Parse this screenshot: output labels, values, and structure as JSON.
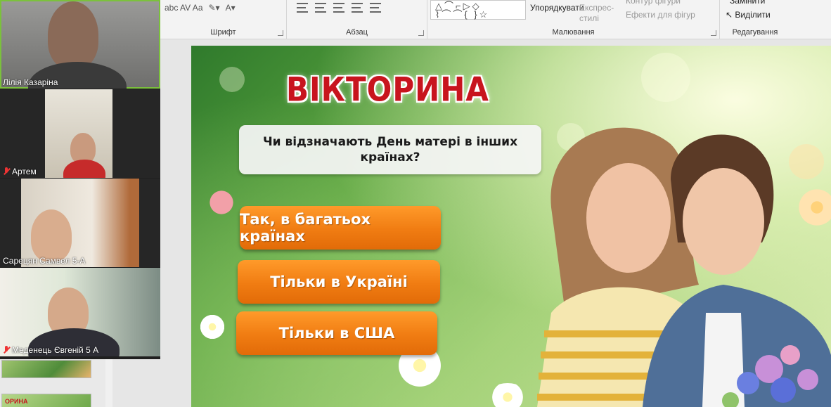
{
  "ribbon": {
    "groups": {
      "font": "Шрифт",
      "paragraph": "Абзац",
      "drawing": "Малювання",
      "editing": "Редагування"
    },
    "font_tools": "abc AV Aa",
    "arrange_label": "Упорядкувати",
    "quick_styles_label": "Експрес-стилі",
    "shape_outline_label": "Контур фігури",
    "shape_effects_label": "Ефекти для фігур",
    "select_label": "Виділити",
    "replace_label": "Замінити"
  },
  "participants": [
    {
      "name": "Лілія Казаріна",
      "muted": false,
      "active": true
    },
    {
      "name": "Артем",
      "muted": true,
      "active": false
    },
    {
      "name": "Сарецян Самвел 5-А",
      "muted": false,
      "active": false
    },
    {
      "name": "Меденець Євгеній 5 А",
      "muted": true,
      "active": false
    }
  ],
  "slide": {
    "title": "ВІКТОРИНА",
    "question": "Чи відзначають День матері в інших країнах?",
    "answers": [
      "Так, в багатьох країнах",
      "Тільки в Україні",
      "Тільки в США"
    ]
  },
  "thumbnails": {
    "partial_title": "ОРИНА"
  },
  "colors": {
    "title": "#c8141e",
    "answer_button": "#f07c12",
    "active_speaker": "#7bc13c"
  }
}
